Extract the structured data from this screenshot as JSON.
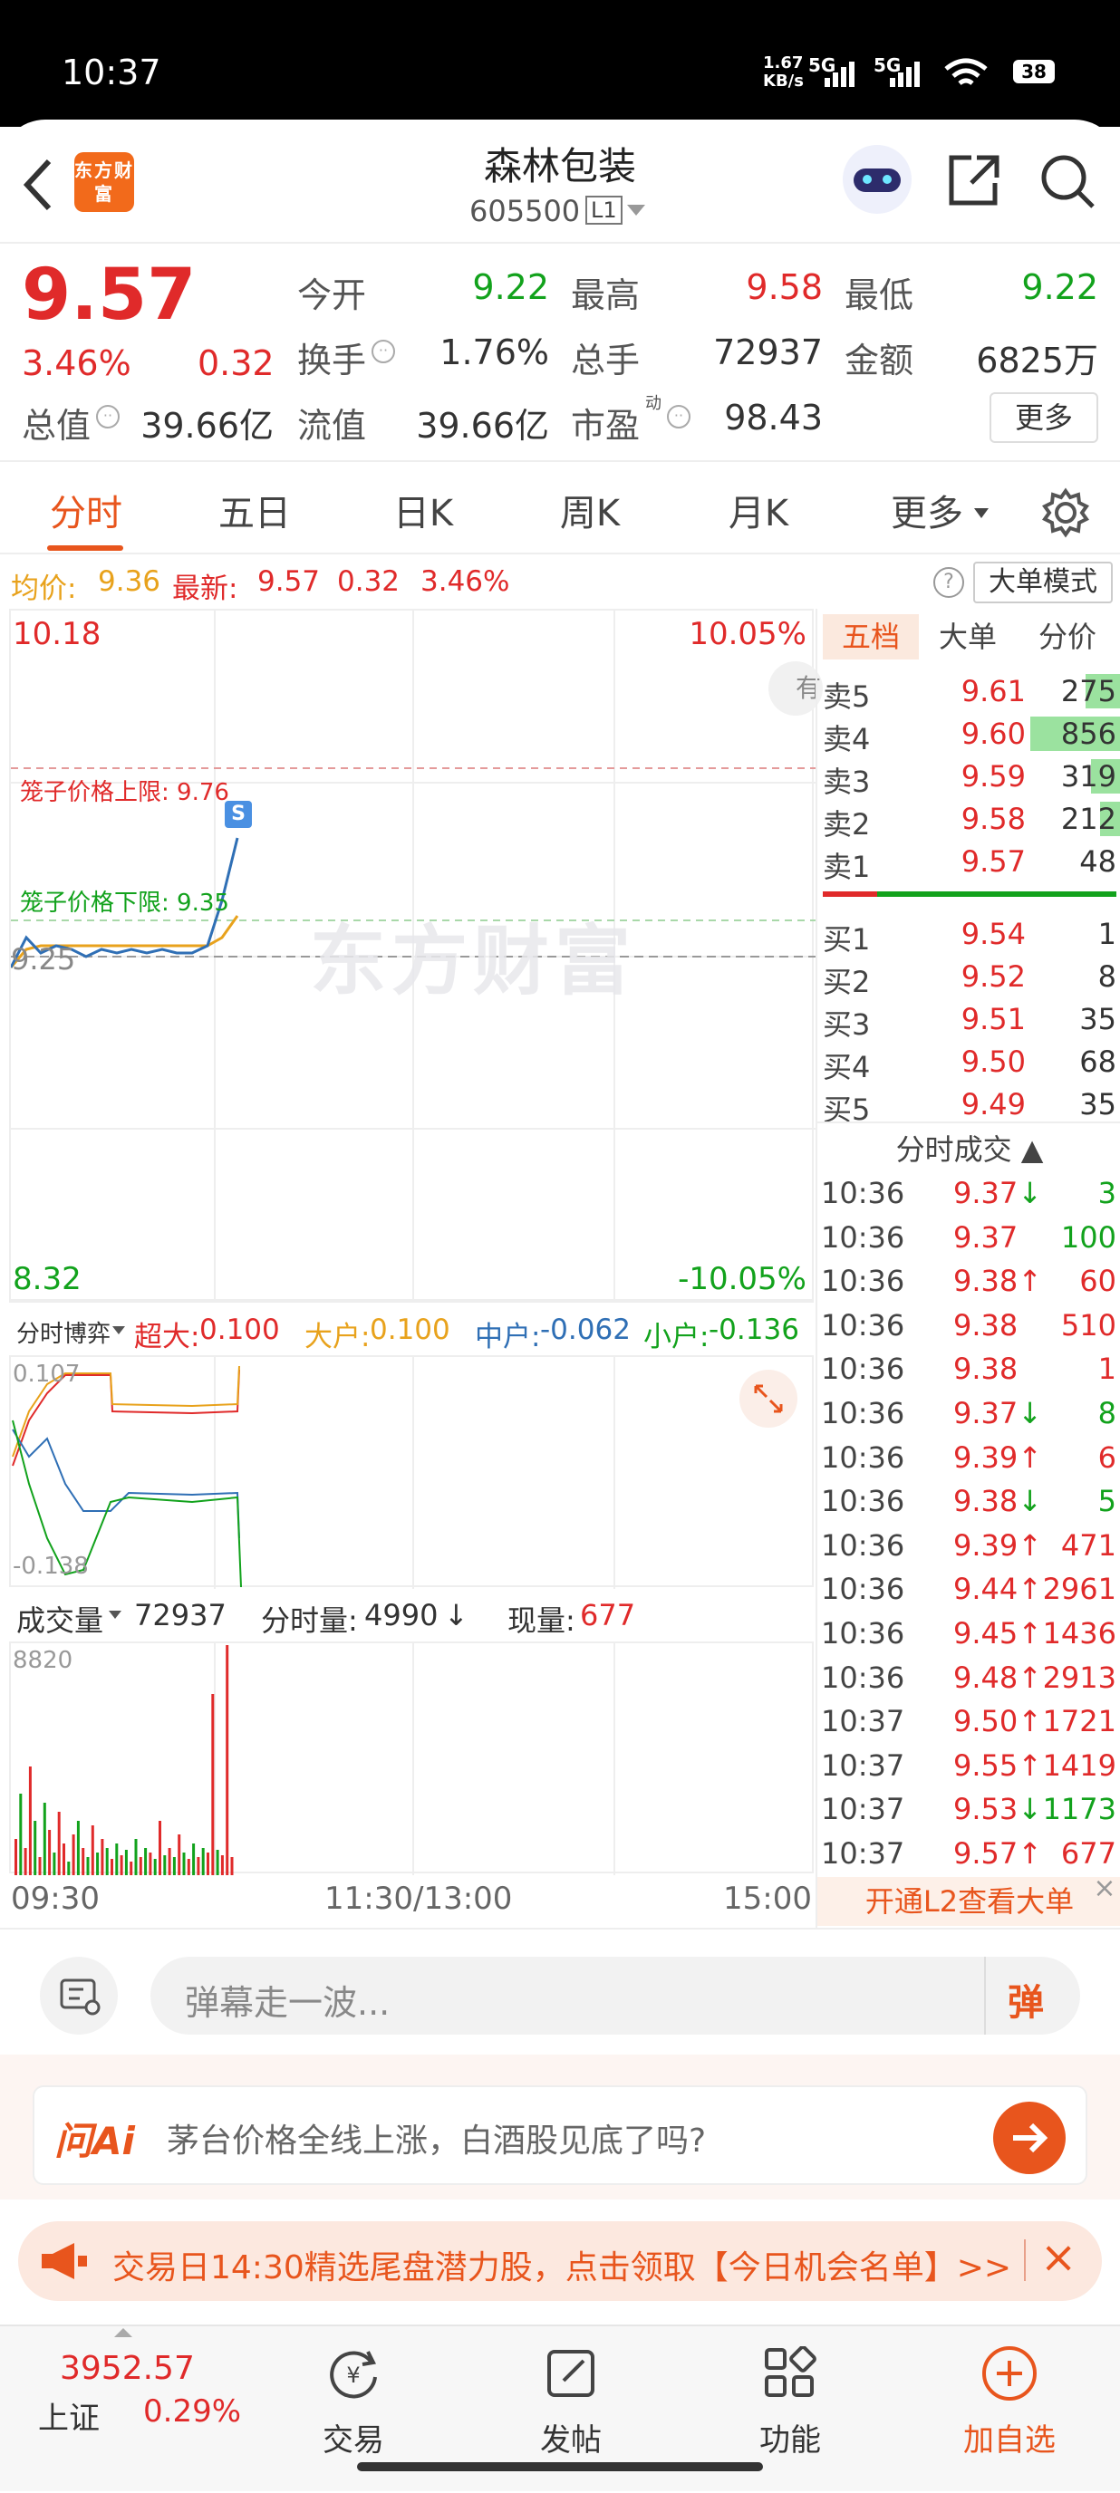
{
  "status_bar": {
    "time": "10:37",
    "net_speed": "1.67\nKB/s",
    "signal1": "5G",
    "signal2": "5G",
    "battery": "38"
  },
  "header": {
    "name": "森林包装",
    "code": "605500",
    "level_badge": "L1",
    "logo_text": "东方财富"
  },
  "quote": {
    "price": "9.57",
    "change_pct": "3.46%",
    "change_amt": "0.32",
    "fields": [
      {
        "label": "今开",
        "value": "9.22",
        "color": "green"
      },
      {
        "label": "最高",
        "value": "9.58",
        "color": "red"
      },
      {
        "label": "最低",
        "value": "9.22",
        "color": "green"
      },
      {
        "label": "换手",
        "value": "1.76%",
        "color": "dark"
      },
      {
        "label": "总手",
        "value": "72937",
        "color": "dark"
      },
      {
        "label": "金额",
        "value": "6825万",
        "color": "dark"
      },
      {
        "label": "总值",
        "value": "39.66亿",
        "color": "dark"
      },
      {
        "label": "流值",
        "value": "39.66亿",
        "color": "dark"
      },
      {
        "label": "市盈",
        "value": "98.43",
        "color": "dark"
      }
    ],
    "pe_superscript": "动",
    "more_label": "更多"
  },
  "tabs": [
    "分时",
    "五日",
    "日K",
    "周K",
    "月K",
    "更多"
  ],
  "info_line": {
    "avg_label": "均价:",
    "avg": "9.36",
    "last_label": "最新:",
    "last": "9.57",
    "chg": "0.32",
    "pct": "3.46%",
    "mode_btn": "大单模式",
    "help": "?"
  },
  "chart": {
    "y_max": "10.18",
    "y_min": "8.32",
    "pct_max": "10.05%",
    "pct_min": "-10.05%",
    "base": "9.25",
    "upper_limit_label": "笼子价格上限: 9.76",
    "lower_limit_label": "笼子价格下限: 9.35",
    "watermark": "东方财富",
    "tag_s": "S",
    "side_tag": "有",
    "x_labels": [
      "09:30",
      "11:30/13:00",
      "15:00"
    ]
  },
  "chart_data": {
    "type": "line",
    "series": [
      {
        "name": "price",
        "x": [
          "09:30",
          "09:35",
          "09:40",
          "09:45",
          "09:50",
          "09:55",
          "10:00",
          "10:05",
          "10:10",
          "10:15",
          "10:20",
          "10:25",
          "10:30",
          "10:34",
          "10:36",
          "10:37"
        ],
        "values": [
          9.22,
          9.3,
          9.26,
          9.28,
          9.27,
          9.25,
          9.27,
          9.26,
          9.27,
          9.26,
          9.27,
          9.26,
          9.26,
          9.28,
          9.4,
          9.57
        ]
      },
      {
        "name": "avg",
        "values": [
          9.22,
          9.27,
          9.28,
          9.28,
          9.28,
          9.28,
          9.28,
          9.28,
          9.28,
          9.28,
          9.28,
          9.28,
          9.28,
          9.28,
          9.3,
          9.36
        ]
      }
    ],
    "ylim": [
      8.32,
      10.18
    ]
  },
  "flow": {
    "selector": "分时博弈",
    "items": [
      {
        "label": "超大:",
        "value": "0.100",
        "color": "red"
      },
      {
        "label": "大户:",
        "value": "0.100",
        "color": "orange"
      },
      {
        "label": "中户:",
        "value": "-0.062",
        "color": "blue"
      },
      {
        "label": "小户:",
        "value": "-0.136",
        "color": "green"
      }
    ],
    "top": "0.107",
    "bottom": "-0.138"
  },
  "volume": {
    "selector": "成交量",
    "total": "72937",
    "minute_label": "分时量:",
    "minute": "4990",
    "arrow": "↓",
    "now_label": "现量:",
    "now": "677",
    "max": "8820"
  },
  "orderbook": {
    "tabs": [
      "五档",
      "大单",
      "分价"
    ],
    "asks": [
      {
        "label": "卖5",
        "price": "9.61",
        "qty": "275",
        "bar": 0.12
      },
      {
        "label": "卖4",
        "price": "9.60",
        "qty": "856",
        "bar": 0.3
      },
      {
        "label": "卖3",
        "price": "9.59",
        "qty": "319",
        "bar": 0.1
      },
      {
        "label": "卖2",
        "price": "9.58",
        "qty": "212",
        "bar": 0.07
      },
      {
        "label": "卖1",
        "price": "9.57",
        "qty": "48",
        "bar": 0
      }
    ],
    "bids": [
      {
        "label": "买1",
        "price": "9.54",
        "qty": "1"
      },
      {
        "label": "买2",
        "price": "9.52",
        "qty": "8"
      },
      {
        "label": "买3",
        "price": "9.51",
        "qty": "35"
      },
      {
        "label": "买4",
        "price": "9.50",
        "qty": "68"
      },
      {
        "label": "买5",
        "price": "9.49",
        "qty": "35"
      }
    ],
    "trades_title": "分时成交",
    "trades": [
      {
        "t": "10:36",
        "p": "9.37",
        "dir": "↓",
        "q": "3",
        "qc": "green"
      },
      {
        "t": "10:36",
        "p": "9.37",
        "dir": "",
        "q": "100",
        "qc": "green"
      },
      {
        "t": "10:36",
        "p": "9.38",
        "dir": "↑",
        "q": "60",
        "qc": "red"
      },
      {
        "t": "10:36",
        "p": "9.38",
        "dir": "",
        "q": "510",
        "qc": "red"
      },
      {
        "t": "10:36",
        "p": "9.38",
        "dir": "",
        "q": "1",
        "qc": "red"
      },
      {
        "t": "10:36",
        "p": "9.37",
        "dir": "↓",
        "q": "8",
        "qc": "green"
      },
      {
        "t": "10:36",
        "p": "9.39",
        "dir": "↑",
        "q": "6",
        "qc": "red"
      },
      {
        "t": "10:36",
        "p": "9.38",
        "dir": "↓",
        "q": "5",
        "qc": "green"
      },
      {
        "t": "10:36",
        "p": "9.39",
        "dir": "↑",
        "q": "471",
        "qc": "red"
      },
      {
        "t": "10:36",
        "p": "9.44",
        "dir": "↑",
        "q": "2961",
        "qc": "red"
      },
      {
        "t": "10:36",
        "p": "9.45",
        "dir": "↑",
        "q": "1436",
        "qc": "red"
      },
      {
        "t": "10:36",
        "p": "9.48",
        "dir": "↑",
        "q": "2913",
        "qc": "red"
      },
      {
        "t": "10:37",
        "p": "9.50",
        "dir": "↑",
        "q": "1721",
        "qc": "red"
      },
      {
        "t": "10:37",
        "p": "9.55",
        "dir": "↑",
        "q": "1419",
        "qc": "red"
      },
      {
        "t": "10:37",
        "p": "9.53",
        "dir": "↓",
        "q": "1173",
        "qc": "green"
      },
      {
        "t": "10:37",
        "p": "9.57",
        "dir": "↑",
        "q": "677",
        "qc": "red"
      }
    ],
    "l2_banner": "开通L2查看大单"
  },
  "danmaku": {
    "placeholder": "弹幕走一波...",
    "btn": "弹"
  },
  "ai": {
    "logo": "问Ai",
    "prompt": "茅台价格全线上涨，白酒股见底了吗?"
  },
  "promo": {
    "text": "交易日14:30精选尾盘潜力股，点击领取【今日机会名单】>>"
  },
  "bottom_nav": {
    "index_value": "3952.57",
    "index_name": "上证",
    "index_pct": "0.29%",
    "items": [
      "交易",
      "发帖",
      "功能",
      "加自选"
    ]
  }
}
